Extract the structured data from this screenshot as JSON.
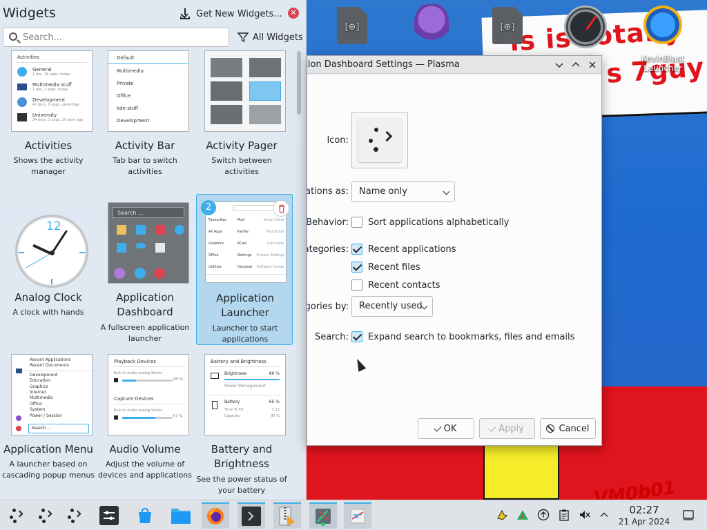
{
  "widgets_panel": {
    "title": "Widgets",
    "get_new_label": "Get New Widgets...",
    "search_placeholder": "Search...",
    "filter_label": "All Widgets",
    "tiles": [
      {
        "name": "Activities",
        "desc": "Shows the activity manager"
      },
      {
        "name": "Activity Bar",
        "desc": "Tab bar to switch activities"
      },
      {
        "name": "Activity Pager",
        "desc": "Switch between activities"
      },
      {
        "name": "Analog Clock",
        "desc": "A clock with hands"
      },
      {
        "name": "Application Dashboard",
        "desc": "A fullscreen application launcher"
      },
      {
        "name": "Application Launcher",
        "desc": "Launcher to start applications",
        "badge": "2"
      },
      {
        "name": "Application Menu",
        "desc": "A launcher based on cascading popup menus"
      },
      {
        "name": "Audio Volume",
        "desc": "Adjust the volume of devices and applications"
      },
      {
        "name": "Battery and Brightness",
        "desc": "See the power status of your battery"
      }
    ],
    "previews": {
      "activities": {
        "header": "Activities",
        "items": [
          {
            "title": "General",
            "sub": "1 doc, 16 apps, today"
          },
          {
            "title": "Multimedia stuff",
            "sub": "1 doc, 2 apps, today"
          },
          {
            "title": "Development",
            "sub": "40 docs, 6 apps, yesterday"
          },
          {
            "title": "University",
            "sub": "34 docs, 3 apps, 19 days ago"
          }
        ]
      },
      "activity_bar": [
        "Default",
        "Multimedia",
        "Private",
        "Office",
        "kde-stuff",
        "Development"
      ],
      "dashboard_search": "Search ...",
      "launcher": {
        "left": [
          "Favourites",
          "All Apps",
          "Graphics",
          "Office",
          "Utilities"
        ],
        "right": [
          "Mail",
          "Kwrite",
          "KCalc",
          "Settings",
          "Discover"
        ],
        "right_sub": [
          "Kmail Client",
          "Text Editor",
          "Calculator",
          "System Settings",
          "Software Center"
        ]
      },
      "app_menu": [
        "Recent Applications",
        "Recent Documents",
        "Development",
        "Education",
        "Graphics",
        "Internet",
        "Multimedia",
        "Office",
        "System",
        "Power / Session",
        "Search ..."
      ],
      "audio": {
        "playback": "Playback Devices",
        "capture": "Capture Devices",
        "device_1": "Built-in Audio Analog Stereo",
        "device_2": "Built-in Audio Analog Stereo",
        "level_1": "28 %",
        "level_2": "67 %",
        "level_1_value": 28,
        "level_2_value": 67
      },
      "battery": {
        "header": "Battery and Brightness",
        "brightness": "Brightness",
        "brightness_pct": "80 %",
        "power_mgmt": "Power Management",
        "battery": "Battery",
        "battery_pct": "65 %",
        "time_to_fill": "Time To Fill:",
        "time_val": "1:12",
        "capacity": "Capacity:",
        "capacity_val": "95 %"
      },
      "clock_number": "12"
    }
  },
  "dialog": {
    "title": "Application Dashboard Settings — Plasma",
    "labels": {
      "icon": "Icon:",
      "show_as": "Show applications as:",
      "behavior": "Behavior:",
      "categories": "Show categories:",
      "sort_by": "Sort items in categories by:",
      "search": "Search:"
    },
    "show_as_value": "Name only",
    "sort_alpha": "Sort applications alphabetically",
    "recent_apps": "Recent applications",
    "recent_files": "Recent files",
    "recent_contacts": "Recent contacts",
    "sort_by_value": "Recently used",
    "expand_search": "Expand search to bookmarks, files and emails",
    "ok_label": "OK",
    "apply_label": "Apply",
    "cancel_label": "Cancel"
  },
  "desktop": {
    "kevinblast_label": "KevinBlast Launcher",
    "wall_text_1": "is is totally",
    "wall_text_2": "s 7guy",
    "wall_vm": "VM0b01"
  },
  "taskbar": {
    "time": "02:27",
    "date": "21 Apr 2024"
  }
}
